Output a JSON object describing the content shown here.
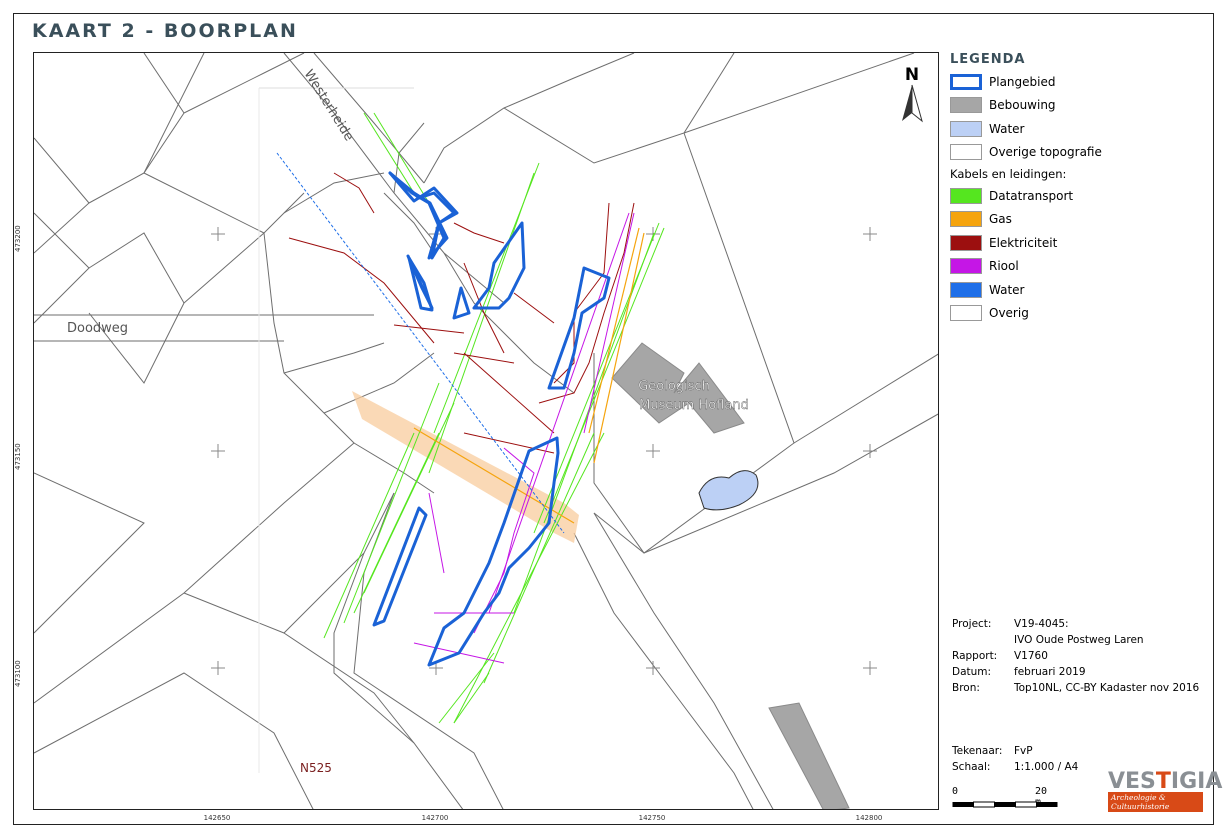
{
  "title": "KAART 2 - BOORPLAN",
  "map_labels": {
    "street_westerheide": "Westerheide",
    "street_doodweg": "Doodweg",
    "road_n525": "N525",
    "building_label_line1": "Geologisch",
    "building_label_line2": "Museum Hofland",
    "north_letter": "N"
  },
  "grid_x_labels": [
    "142650",
    "142700",
    "142750",
    "142800"
  ],
  "grid_y_labels": [
    "473200",
    "473150",
    "473100"
  ],
  "legend": {
    "title": "LEGENDA",
    "items": [
      {
        "label": "Plangebied",
        "color": "#1a62d6",
        "style": "outline"
      },
      {
        "label": "Bebouwing",
        "color": "#a6a6a6",
        "style": "fill"
      },
      {
        "label": "Water",
        "color": "#bcd0f5",
        "style": "fill"
      },
      {
        "label": "Overige topografie",
        "color": "#ffffff",
        "style": "fill"
      }
    ],
    "cables_header": "Kabels en leidingen:",
    "cables": [
      {
        "label": "Datatransport",
        "color": "#55e61f"
      },
      {
        "label": "Gas",
        "color": "#f5a40e"
      },
      {
        "label": "Elektriciteit",
        "color": "#9c0f0f"
      },
      {
        "label": "Riool",
        "color": "#c516e6"
      },
      {
        "label": "Water",
        "color": "#1f6fe8"
      },
      {
        "label": "Overig",
        "color": "#ffffff"
      }
    ]
  },
  "project_info": [
    {
      "key": "Project:",
      "value": "V19-4045:"
    },
    {
      "key": "",
      "value": "IVO Oude Postweg Laren"
    },
    {
      "key": "Rapport:",
      "value": "V1760"
    },
    {
      "key": "Datum:",
      "value": "februari 2019"
    },
    {
      "key": "Bron:",
      "value": "Top10NL, CC-BY Kadaster nov 2016"
    }
  ],
  "drawing_info": [
    {
      "key": "Tekenaar:",
      "value": "FvP"
    },
    {
      "key": "Schaal:",
      "value": "1:1.000   /  A4"
    }
  ],
  "scalebar": {
    "start": "0",
    "end": "20 m"
  },
  "logo": {
    "main_left": "VES",
    "main_highlight": "T",
    "main_right": "IGIA",
    "sub": "Archeologie & Cultuurhistorie"
  }
}
